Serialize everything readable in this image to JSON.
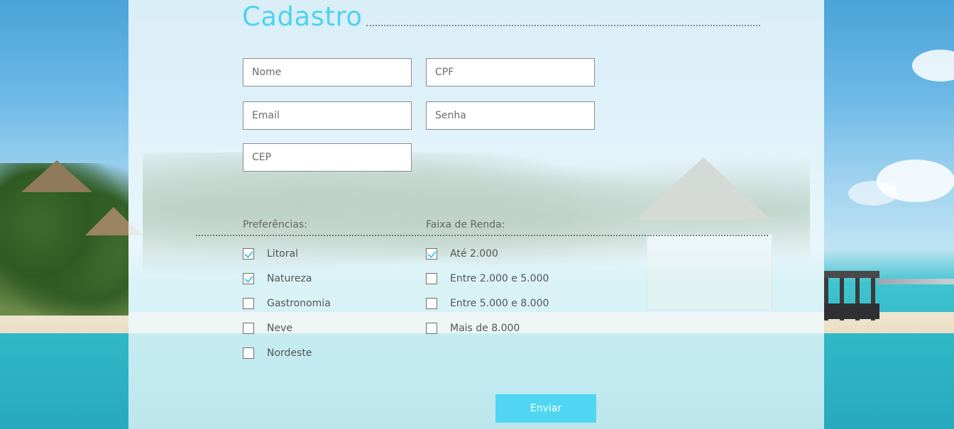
{
  "form": {
    "title": "Cadastro",
    "fields": {
      "nome": {
        "value": "",
        "placeholder": "Nome"
      },
      "cpf": {
        "value": "",
        "placeholder": "CPF"
      },
      "email": {
        "value": "",
        "placeholder": "Email"
      },
      "senha": {
        "value": "",
        "placeholder": "Senha"
      },
      "cep": {
        "value": "",
        "placeholder": "CEP"
      }
    },
    "preferences": {
      "label": "Preferências:",
      "options": [
        {
          "label": "Litoral",
          "checked": true
        },
        {
          "label": "Natureza",
          "checked": true
        },
        {
          "label": "Gastronomia",
          "checked": false
        },
        {
          "label": "Neve",
          "checked": false
        },
        {
          "label": "Nordeste",
          "checked": false
        }
      ]
    },
    "income": {
      "label": "Faixa de Renda:",
      "options": [
        {
          "label": "Até 2.000",
          "checked": true
        },
        {
          "label": "Entre 2.000 e 5.000",
          "checked": false
        },
        {
          "label": "Entre 5.000 e 8.000",
          "checked": false
        },
        {
          "label": "Mais de 8.000",
          "checked": false
        }
      ]
    },
    "submit_label": "Enviar"
  },
  "colors": {
    "accent": "#50d6f3",
    "check": "#4fc6e6",
    "title": "#4fd2ee"
  }
}
